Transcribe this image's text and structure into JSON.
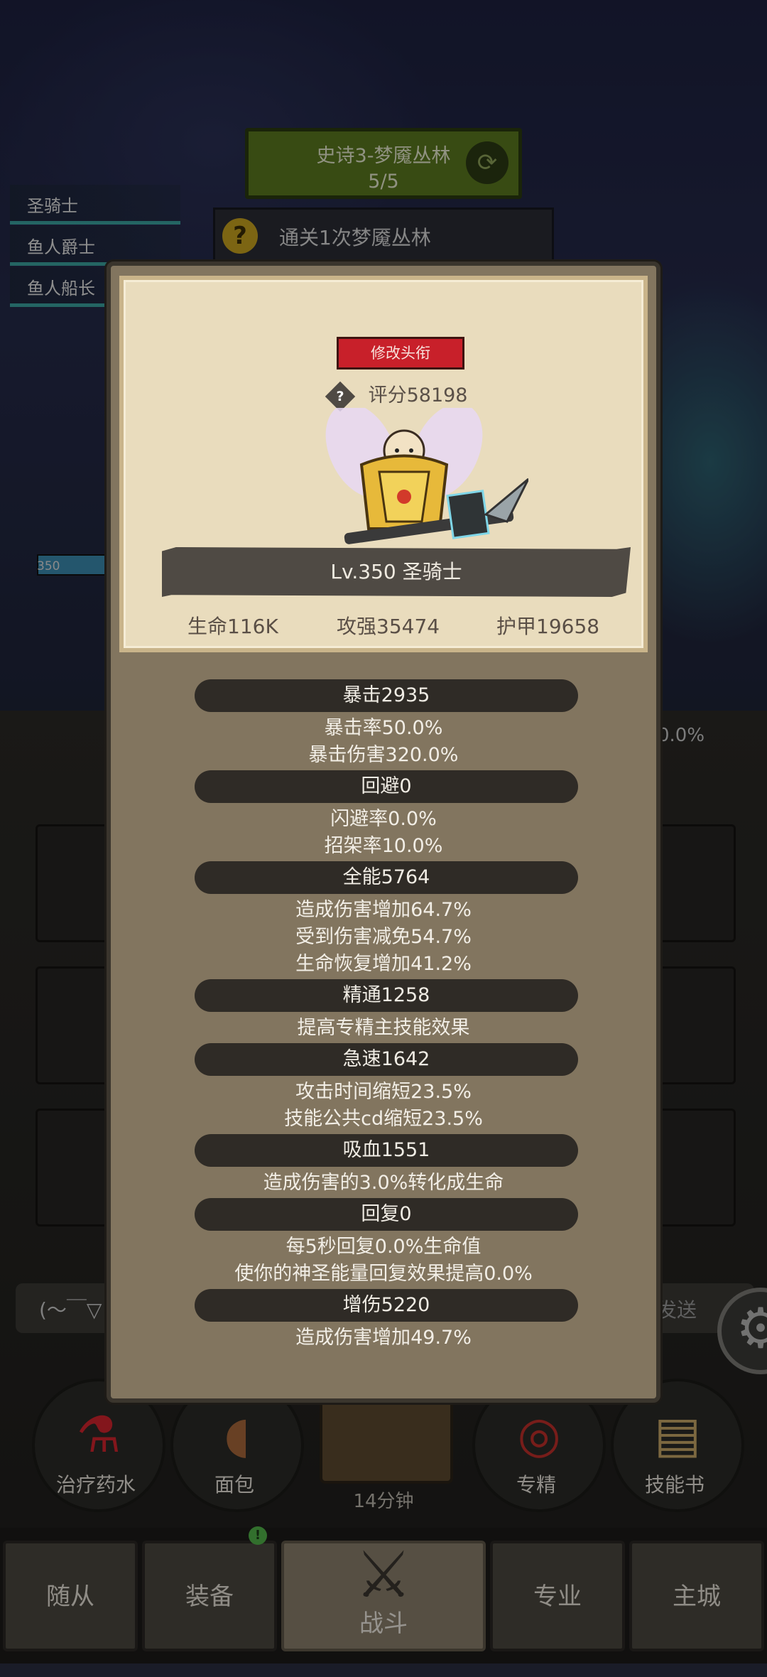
{
  "background": {
    "stage": {
      "title": "史诗3-梦魇丛林",
      "progress": "5/5"
    },
    "quest": {
      "text": "通关1次梦魇丛林"
    },
    "party": [
      "圣骑士",
      "鱼人爵士",
      "鱼人船长"
    ],
    "level_badge": "350",
    "timer_right": "0.0%",
    "chat": {
      "emoji": "(～￣▽",
      "send": "发送"
    },
    "consumables": [
      {
        "label": "治疗药水",
        "icon": "potion-icon"
      },
      {
        "label": "面包",
        "icon": "bread-icon"
      },
      {
        "label": "14分钟",
        "icon": "chest-icon"
      },
      {
        "label": "专精",
        "icon": "specialization-icon"
      },
      {
        "label": "技能书",
        "icon": "skillbook-icon"
      }
    ],
    "nav": [
      "随从",
      "装备",
      "战斗",
      "专业",
      "主城"
    ],
    "nav_badge": "!"
  },
  "modal": {
    "rename_button": "修改头衔",
    "score": "评分58198",
    "level_title": "Lv.350 圣骑士",
    "stats": {
      "hp": "生命116K",
      "attack": "攻强35474",
      "armor": "护甲19658"
    },
    "sections": [
      {
        "title": "暴击2935",
        "lines": [
          "暴击率50.0%",
          "暴击伤害320.0%"
        ]
      },
      {
        "title": "回避0",
        "lines": [
          "闪避率0.0%",
          "招架率10.0%"
        ]
      },
      {
        "title": "全能5764",
        "lines": [
          "造成伤害增加64.7%",
          "受到伤害减免54.7%",
          "生命恢复增加41.2%"
        ]
      },
      {
        "title": "精通1258",
        "lines": [
          "提高专精主技能效果"
        ]
      },
      {
        "title": "急速1642",
        "lines": [
          "攻击时间缩短23.5%",
          "技能公共cd缩短23.5%"
        ]
      },
      {
        "title": "吸血1551",
        "lines": [
          "造成伤害的3.0%转化成生命"
        ]
      },
      {
        "title": "回复0",
        "lines": [
          "每5秒回复0.0%生命值",
          "使你的神圣能量回复效果提高0.0%"
        ]
      },
      {
        "title": "增伤5220",
        "lines": [
          "造成伤害增加49.7%"
        ]
      }
    ]
  },
  "colors": {
    "panel": "#82755f",
    "parchment": "#e9dcbd",
    "section_bar": "#2f2b26",
    "rename_red": "#c8202a",
    "nav_badge_green": "#52b34a"
  }
}
